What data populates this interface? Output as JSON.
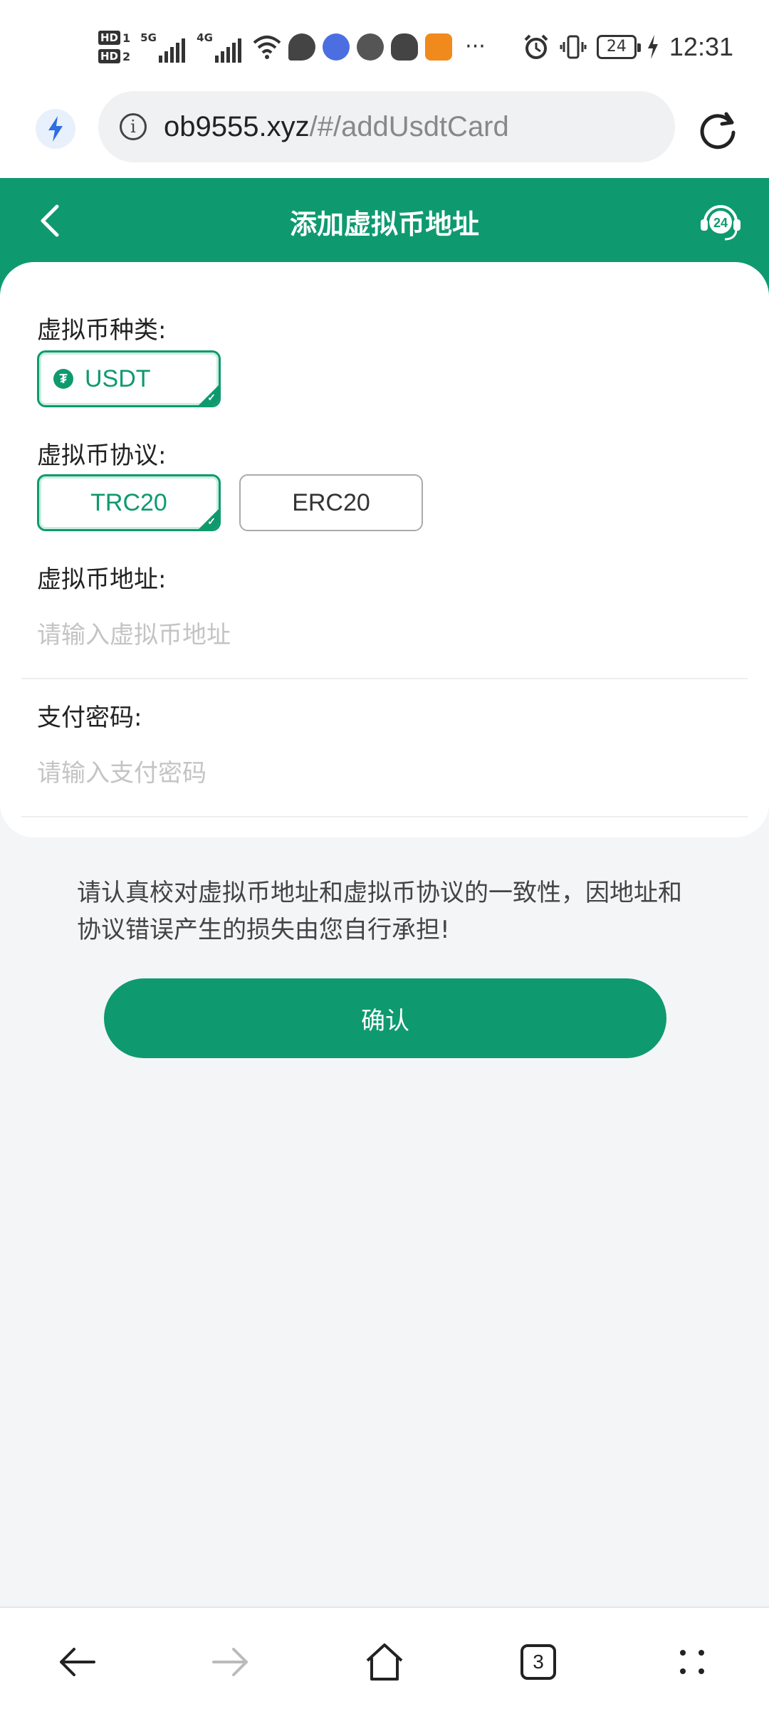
{
  "status_bar": {
    "sim1_label": "HD",
    "sim1_num": "1",
    "sim2_label": "HD",
    "sim2_num": "2",
    "net1": "5G",
    "net2": "4G",
    "more": "···",
    "battery": "24",
    "time": "12:31"
  },
  "browser": {
    "url_host": "ob9555.xyz",
    "url_path": "/#/addUsdtCard",
    "tab_count": "3"
  },
  "header": {
    "title": "添加虚拟币地址",
    "support_badge": "24"
  },
  "form": {
    "coin_type_label": "虚拟币种类:",
    "coin_options": [
      {
        "label": "USDT",
        "selected": true
      }
    ],
    "protocol_label": "虚拟币协议:",
    "protocol_options": [
      {
        "label": "TRC20",
        "selected": true
      },
      {
        "label": "ERC20",
        "selected": false
      }
    ],
    "address_label": "虚拟币地址:",
    "address_placeholder": "请输入虚拟币地址",
    "address_value": "",
    "password_label": "支付密码:",
    "password_placeholder": "请输入支付密码",
    "password_value": ""
  },
  "notice": "请认真校对虚拟币地址和虚拟币协议的一致性，因地址和协议错误产生的损失由您自行承担!",
  "confirm_label": "确认",
  "colors": {
    "brand_green": "#0e9a6e",
    "background": "#f4f5f7"
  }
}
